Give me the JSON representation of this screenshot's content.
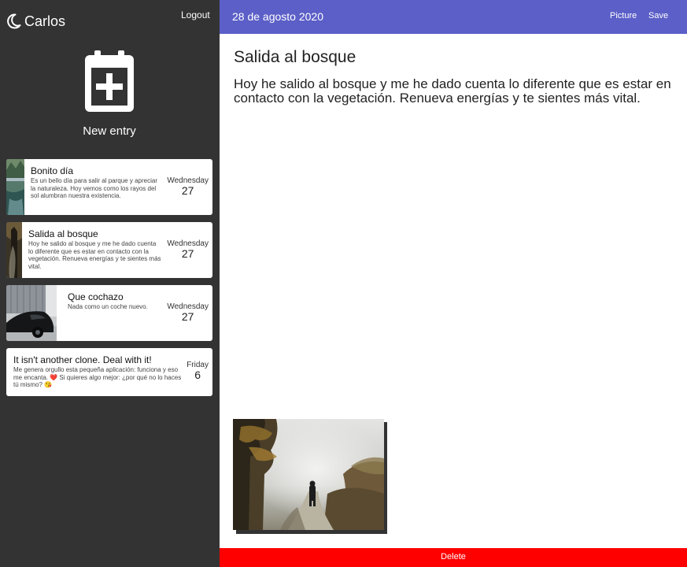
{
  "sidebar": {
    "user_name": "Carlos",
    "logout_label": "Logout",
    "new_entry_label": "New entry",
    "entries": [
      {
        "title": "Bonito día",
        "excerpt": "Es un bello día para salir al parque y apreciar la naturaleza. Hoy vemos como los rayos del sol alumbran nuestra existencia.",
        "day_name": "Wednesday",
        "day_num": "27",
        "thumb": "forest-river-thumbnail"
      },
      {
        "title": "Salida al bosque",
        "excerpt": "Hoy he salido al bosque y me he dado cuenta lo diferente que es estar en contacto con la vegetación. Renueva energías y te sientes más vital.",
        "day_name": "Wednesday",
        "day_num": "27",
        "thumb": "forest-path-thumbnail"
      },
      {
        "title": "Que cochazo",
        "excerpt": "Nada como un coche nuevo.",
        "day_name": "Wednesday",
        "day_num": "27",
        "thumb": "car-thumbnail"
      },
      {
        "title": "It isn't another clone. Deal with it!",
        "excerpt": "Me genera orgullo esta pequeña aplicación: funciona y eso me encanta. ❤️ Si quieres algo mejor: ¿por qué no lo haces tú mismo? 😘",
        "day_name": "Friday",
        "day_num": "6"
      }
    ]
  },
  "topbar": {
    "date": "28 de agosto 2020",
    "picture_label": "Picture",
    "save_label": "Save"
  },
  "entry": {
    "title": "Salida al bosque",
    "body": "Hoy he salido al bosque y me he dado cuenta lo diferente que es estar en contacto con la vegetación. Renueva energías y te sientes más vital."
  },
  "delete_label": "Delete",
  "colors": {
    "sidebar_bg": "#333333",
    "topbar_bg": "#5b5fc7",
    "delete_bg": "#ff0000"
  },
  "icons": {
    "user": "moon-icon",
    "new_entry": "calendar-plus-icon"
  }
}
